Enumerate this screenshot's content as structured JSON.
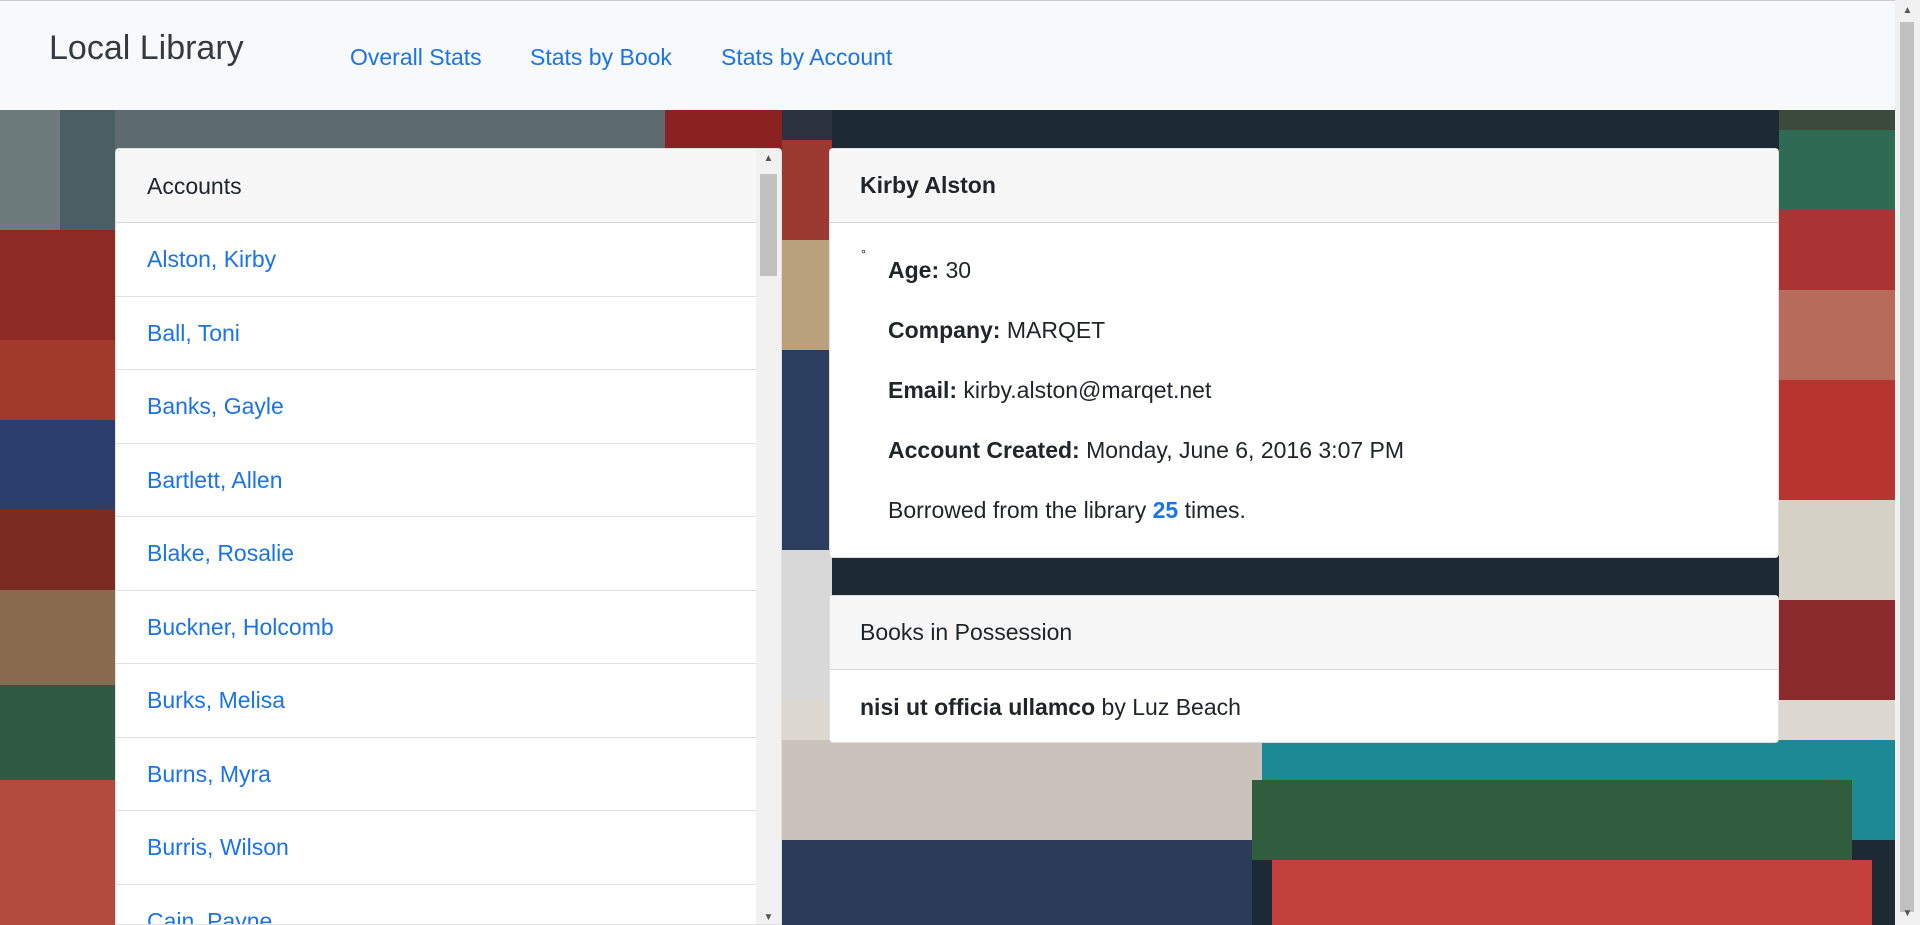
{
  "navbar": {
    "brand": "Local Library",
    "links": [
      "Overall Stats",
      "Stats by Book",
      "Stats by Account"
    ]
  },
  "accounts": {
    "header": "Accounts",
    "items": [
      "Alston, Kirby",
      "Ball, Toni",
      "Banks, Gayle",
      "Bartlett, Allen",
      "Blake, Rosalie",
      "Buckner, Holcomb",
      "Burks, Melisa",
      "Burns, Myra",
      "Burris, Wilson",
      "Cain, Payne"
    ]
  },
  "detail": {
    "name": "Kirby Alston",
    "bullet": "∘",
    "age_label": "Age:",
    "age": "30",
    "company_label": "Company:",
    "company": "MARQET",
    "email_label": "Email:",
    "email": "kirby.alston@marqet.net",
    "created_label": "Account Created:",
    "created": "Monday, June 6, 2016 3:07 PM",
    "borrowed_prefix": "Borrowed from the library",
    "borrowed_count": "25",
    "borrowed_suffix": "times."
  },
  "books": {
    "header": "Books in Possession",
    "title": "nisi ut officia ullamco",
    "by": "by",
    "author": "Luz Beach"
  },
  "colors": {
    "link": "#1a73e8",
    "navbar_bg": "#f8f9fa",
    "card_header_bg": "#f7f7f7"
  }
}
